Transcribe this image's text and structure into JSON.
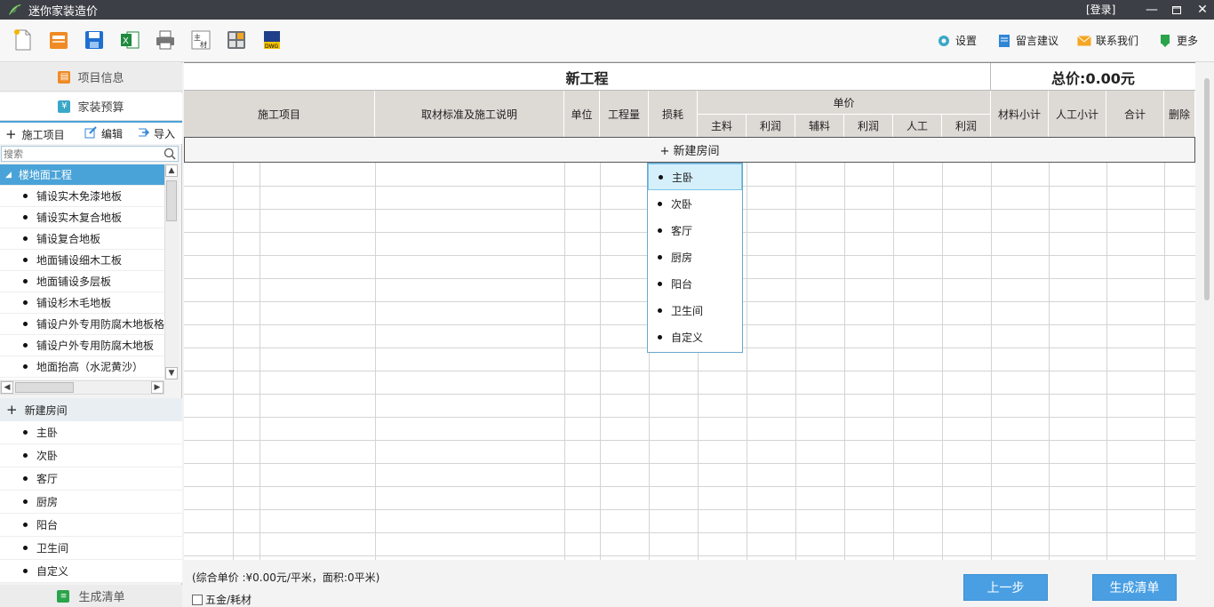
{
  "app": {
    "title": "迷你家装造价",
    "login": "[登录]"
  },
  "toolbar_right": {
    "settings": "设置",
    "feedback": "留言建议",
    "contact": "联系我们",
    "more": "更多"
  },
  "sidebar": {
    "tab_project_info": "项目信息",
    "tab_budget": "家装预算",
    "action_item": "施工项目",
    "action_edit": "编辑",
    "action_import": "导入",
    "search_placeholder": "搜索",
    "tree_root": "楼地面工程",
    "tree_items": [
      "铺设实木免漆地板",
      "铺设实木复合地板",
      "铺设复合地板",
      "地面铺设细木工板",
      "地面铺设多层板",
      "铺设杉木毛地板",
      "铺设户外专用防腐木地板格",
      "铺设户外专用防腐木地板",
      "地面抬高（水泥黄沙）"
    ],
    "new_room": "新建房间",
    "rooms": [
      "主卧",
      "次卧",
      "客厅",
      "厨房",
      "阳台",
      "卫生间",
      "自定义"
    ],
    "tab_generate": "生成清单"
  },
  "table": {
    "project_title": "新工程",
    "total_price": "总价:0.00元",
    "columns": {
      "item": "施工项目",
      "standard": "取材标准及施工说明",
      "unit": "单位",
      "quantity": "工程量",
      "loss": "损耗",
      "unit_price": "单价",
      "main_material": "主料",
      "profit1": "利润",
      "aux_material": "辅料",
      "profit2": "利润",
      "labor": "人工",
      "profit3": "利润",
      "material_subtotal": "材料小计",
      "labor_subtotal": "人工小计",
      "total": "合计",
      "delete": "删除"
    },
    "new_room_button": "+ 新建房间"
  },
  "dropdown": {
    "items": [
      "主卧",
      "次卧",
      "客厅",
      "厨房",
      "阳台",
      "卫生间",
      "自定义"
    ],
    "highlighted": "主卧"
  },
  "footer": {
    "note": "(综合单价 :¥0.00元/平米，面积:0平米)",
    "checkbox_label": "五金/耗材",
    "prev_button": "上一步",
    "generate_button": "生成清单"
  },
  "colors": {
    "accent": "#4aa3d8",
    "button": "#4a9fe3",
    "header_bg": "#ddd9d5",
    "titlebar": "#3c3f46"
  }
}
